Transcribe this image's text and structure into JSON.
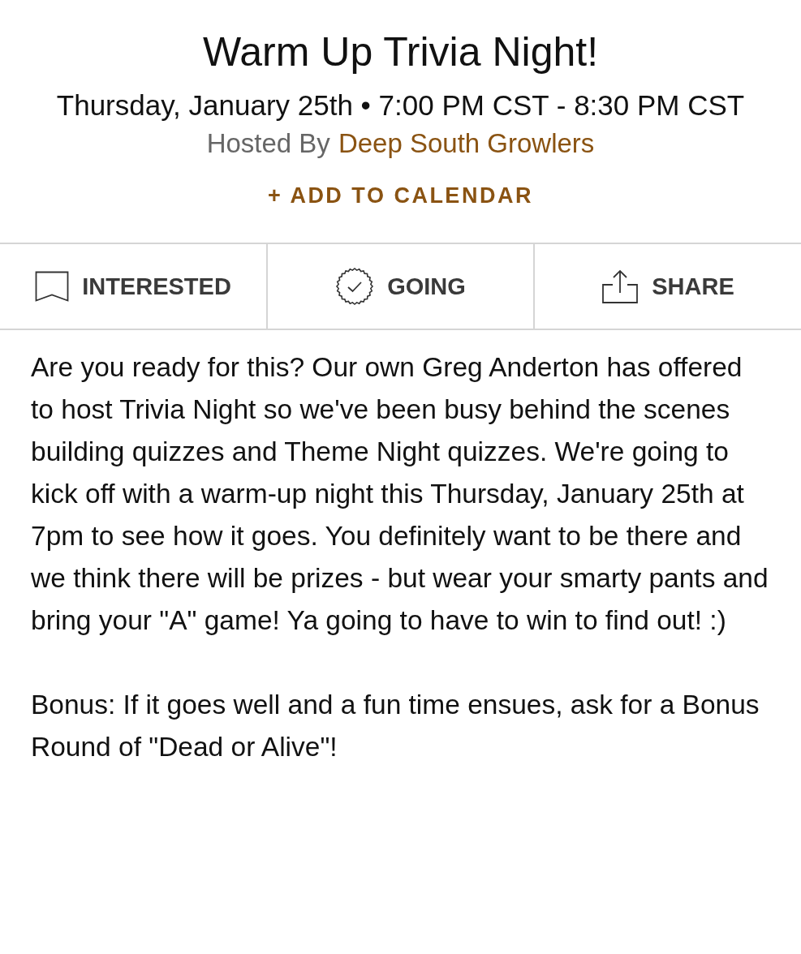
{
  "event": {
    "title": "Warm Up Trivia Night!",
    "datetime": "Thursday, January 25th • 7:00 PM CST - 8:30 PM CST",
    "hosted_by_label": "Hosted By",
    "host": "Deep South Growlers",
    "add_to_calendar": "+ ADD TO CALENDAR"
  },
  "actions": [
    {
      "kind": "bookmark",
      "label": "INTERESTED"
    },
    {
      "kind": "badge",
      "label": "GOING"
    },
    {
      "kind": "share",
      "label": "SHARE"
    }
  ],
  "description": [
    "Are you ready for this? Our own Greg Anderton has offered to host Trivia Night so we've been busy behind the scenes building quizzes and Theme Night quizzes. We're going to kick off with a warm-up night this Thursday, January 25th at 7pm to see how it goes. You definitely want to be there and we think there will be prizes - but wear your smarty pants and bring your \"A\" game! Ya going to have to win to find out! :)",
    "Bonus: If it goes well and a fun time ensues, ask for a Bonus Round of \"Dead or Alive\"!"
  ]
}
